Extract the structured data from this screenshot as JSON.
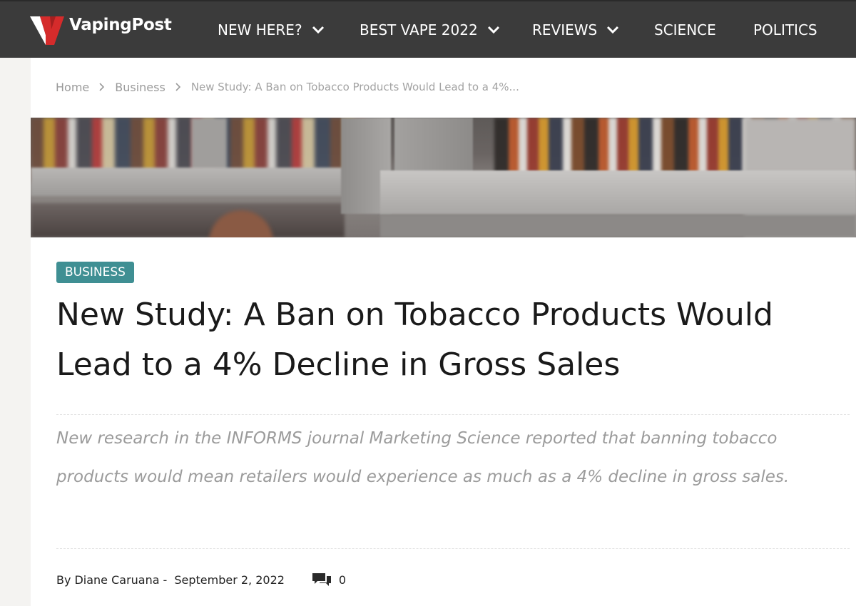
{
  "header": {
    "logo_text": "VapingPost",
    "nav": [
      {
        "label": "NEW HERE?",
        "has_dropdown": true
      },
      {
        "label": "BEST VAPE 2022",
        "has_dropdown": true
      },
      {
        "label": "REVIEWS",
        "has_dropdown": true
      },
      {
        "label": "SCIENCE",
        "has_dropdown": false
      },
      {
        "label": "POLITICS",
        "has_dropdown": false
      }
    ],
    "colors": {
      "bar": "#3b3b3b",
      "logo_red": "#d52b2b"
    }
  },
  "breadcrumb": {
    "home": "Home",
    "section": "Business",
    "current": "New Study: A Ban on Tobacco Products Would Lead to a 4%..."
  },
  "hero_image": {
    "icon": "store-shelves-photo"
  },
  "article": {
    "category": "BUSINESS",
    "category_color": "#3f8f93",
    "title": "New Study: A Ban on Tobacco Products Would Lead to a 4% Decline in Gross Sales",
    "excerpt": "New research in the INFORMS journal Marketing Science reported that banning tobacco products would mean retailers would experience as much as a 4% decline in gross sales.",
    "byline_prefix": "By",
    "author": "Diane Caruana",
    "separator": "-",
    "date": "September 2, 2022",
    "comment_count": "0",
    "comment_icon": "comments-icon"
  }
}
